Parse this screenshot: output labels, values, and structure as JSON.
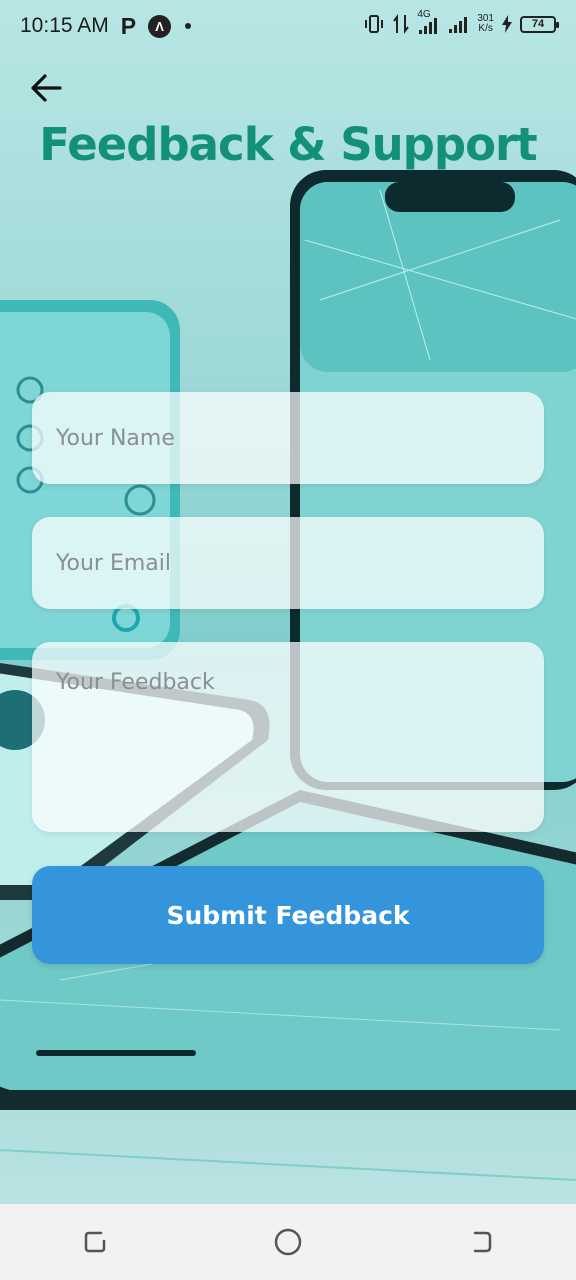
{
  "status_bar": {
    "time": "10:15 AM",
    "app_icon_1": "P",
    "app_icon_2": "Λ",
    "network": "4G",
    "speed_value": "301",
    "speed_unit": "K/s",
    "battery": "74"
  },
  "header": {
    "back_icon": "arrow-left-icon",
    "title": "Feedback & Support"
  },
  "form": {
    "name_placeholder": "Your Name",
    "email_placeholder": "Your Email",
    "feedback_placeholder": "Your Feedback",
    "submit_label": "Submit Feedback"
  },
  "nav_bar": {
    "recents_icon": "recents-icon",
    "home_icon": "home-circle-icon",
    "back_icon": "nav-back-icon"
  },
  "colors": {
    "title": "#139078",
    "submit": "#3495dc",
    "background": "#9fd9d8"
  }
}
